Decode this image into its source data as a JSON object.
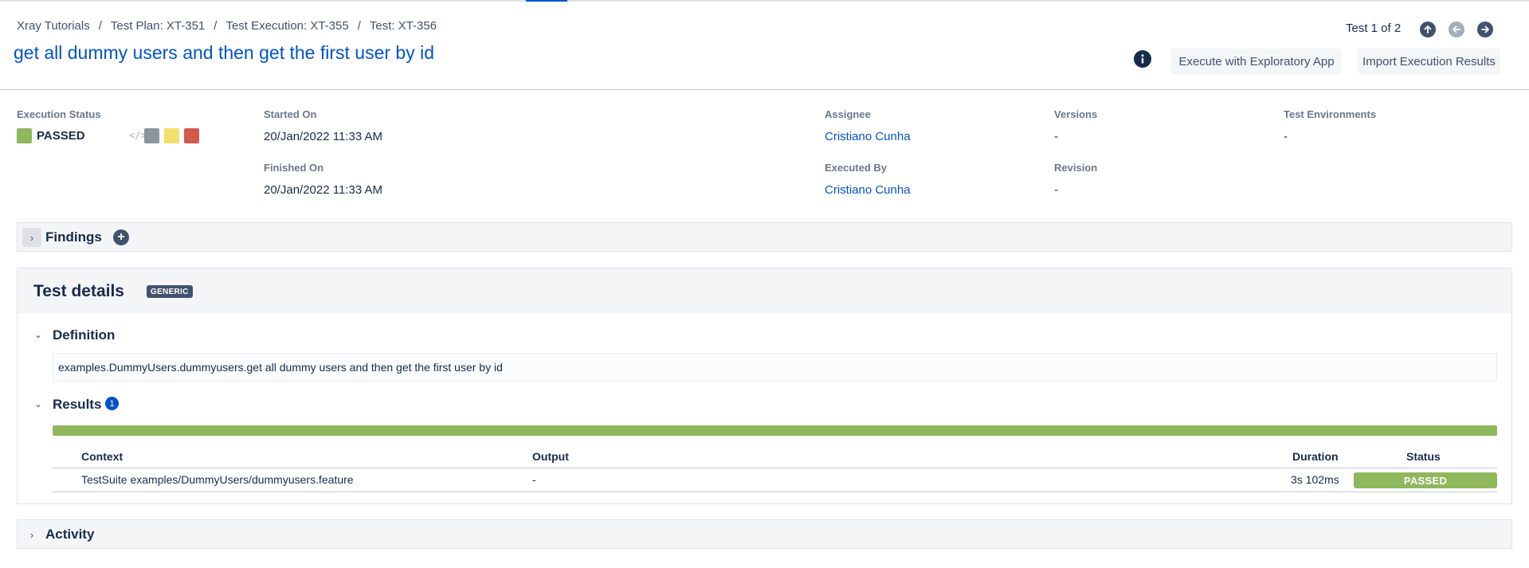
{
  "breadcrumb": [
    "Xray Tutorials",
    "Test Plan: XT-351",
    "Test Execution: XT-355",
    "Test: XT-356"
  ],
  "breadcrumb_separator": "/",
  "title": "get all dummy users and then get the first user by id",
  "pager": {
    "text": "Test 1 of 2"
  },
  "buttons": {
    "exploratory": "Execute with Exploratory App",
    "import": "Import Execution Results"
  },
  "summary": {
    "execution_status_label": "Execution Status",
    "execution_status": "PASSED",
    "status_color": "#8fb75c",
    "started_on_label": "Started On",
    "started_on": "20/Jan/2022 11:33 AM",
    "finished_on_label": "Finished On",
    "finished_on": "20/Jan/2022 11:33 AM",
    "assignee_label": "Assignee",
    "assignee": "Cristiano Cunha",
    "executed_by_label": "Executed By",
    "executed_by": "Cristiano Cunha",
    "versions_label": "Versions",
    "versions": "-",
    "revision_label": "Revision",
    "revision": "-",
    "environments_label": "Test Environments",
    "environments": "-"
  },
  "findings": {
    "title": "Findings"
  },
  "details": {
    "title": "Test details",
    "badge": "GENERIC",
    "definition_title": "Definition",
    "definition": "examples.DummyUsers.dummyusers.get all dummy users and then get the first user by id",
    "results_title": "Results",
    "results_count": "1",
    "progress_passed_fraction": 1.0,
    "table": {
      "headers": {
        "context": "Context",
        "output": "Output",
        "duration": "Duration",
        "status": "Status"
      },
      "rows": [
        {
          "context": "TestSuite examples/DummyUsers/dummyusers.feature",
          "output": "-",
          "duration": "3s 102ms",
          "status": "PASSED"
        }
      ]
    }
  },
  "activity": {
    "title": "Activity"
  }
}
